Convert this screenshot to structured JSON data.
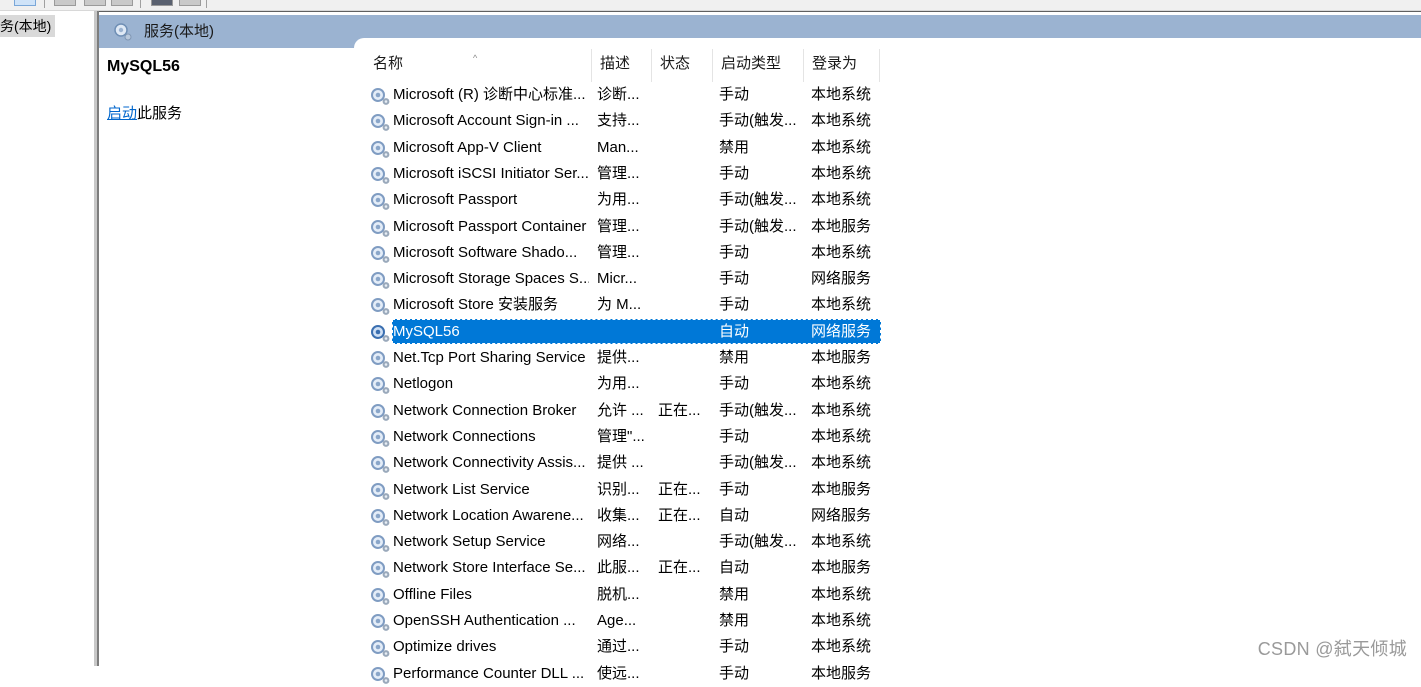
{
  "toolbar": {
    "buttons": [
      "view-extended",
      "view-standard-1",
      "view-standard-2",
      "view-standard-3",
      "properties",
      "help"
    ]
  },
  "tree": {
    "selected_item": "务(本地)"
  },
  "pane": {
    "header_title": "服务(本地)",
    "header_icon": "gear-icon"
  },
  "detail": {
    "service_name": "MySQL56",
    "action_link": "启动",
    "action_suffix": "此服务"
  },
  "table": {
    "columns": [
      "名称",
      "描述",
      "状态",
      "启动类型",
      "登录为"
    ],
    "sorted_column": "名称",
    "selected_row": "MySQL56",
    "rows": [
      {
        "name": "Microsoft (R) 诊断中心标准...",
        "desc": "诊断...",
        "status": "",
        "startup": "手动",
        "logon": "本地系统"
      },
      {
        "name": "Microsoft Account Sign-in ...",
        "desc": "支持...",
        "status": "",
        "startup": "手动(触发...",
        "logon": "本地系统"
      },
      {
        "name": "Microsoft App-V Client",
        "desc": "Man...",
        "status": "",
        "startup": "禁用",
        "logon": "本地系统"
      },
      {
        "name": "Microsoft iSCSI Initiator Ser...",
        "desc": "管理...",
        "status": "",
        "startup": "手动",
        "logon": "本地系统"
      },
      {
        "name": "Microsoft Passport",
        "desc": "为用...",
        "status": "",
        "startup": "手动(触发...",
        "logon": "本地系统"
      },
      {
        "name": "Microsoft Passport Container",
        "desc": "管理...",
        "status": "",
        "startup": "手动(触发...",
        "logon": "本地服务"
      },
      {
        "name": "Microsoft Software Shado...",
        "desc": "管理...",
        "status": "",
        "startup": "手动",
        "logon": "本地系统"
      },
      {
        "name": "Microsoft Storage Spaces S...",
        "desc": "Micr...",
        "status": "",
        "startup": "手动",
        "logon": "网络服务"
      },
      {
        "name": "Microsoft Store 安装服务",
        "desc": "为 M...",
        "status": "",
        "startup": "手动",
        "logon": "本地系统"
      },
      {
        "name": "MySQL56",
        "desc": "",
        "status": "",
        "startup": "自动",
        "logon": "网络服务"
      },
      {
        "name": "Net.Tcp Port Sharing Service",
        "desc": "提供...",
        "status": "",
        "startup": "禁用",
        "logon": "本地服务"
      },
      {
        "name": "Netlogon",
        "desc": "为用...",
        "status": "",
        "startup": "手动",
        "logon": "本地系统"
      },
      {
        "name": "Network Connection Broker",
        "desc": "允许 ...",
        "status": "正在...",
        "startup": "手动(触发...",
        "logon": "本地系统"
      },
      {
        "name": "Network Connections",
        "desc": "管理\"...",
        "status": "",
        "startup": "手动",
        "logon": "本地系统"
      },
      {
        "name": "Network Connectivity Assis...",
        "desc": "提供 ...",
        "status": "",
        "startup": "手动(触发...",
        "logon": "本地系统"
      },
      {
        "name": "Network List Service",
        "desc": "识别...",
        "status": "正在...",
        "startup": "手动",
        "logon": "本地服务"
      },
      {
        "name": "Network Location Awarene...",
        "desc": "收集...",
        "status": "正在...",
        "startup": "自动",
        "logon": "网络服务"
      },
      {
        "name": "Network Setup Service",
        "desc": "网络...",
        "status": "",
        "startup": "手动(触发...",
        "logon": "本地系统"
      },
      {
        "name": "Network Store Interface Se...",
        "desc": "此服...",
        "status": "正在...",
        "startup": "自动",
        "logon": "本地服务"
      },
      {
        "name": "Offline Files",
        "desc": "脱机...",
        "status": "",
        "startup": "禁用",
        "logon": "本地系统"
      },
      {
        "name": "OpenSSH Authentication ...",
        "desc": "Age...",
        "status": "",
        "startup": "禁用",
        "logon": "本地系统"
      },
      {
        "name": "Optimize drives",
        "desc": "通过...",
        "status": "",
        "startup": "手动",
        "logon": "本地系统"
      },
      {
        "name": "Performance Counter DLL ...",
        "desc": "使远...",
        "status": "",
        "startup": "手动",
        "logon": "本地服务"
      }
    ]
  },
  "colors": {
    "header_bg": "#9bb3d1",
    "selection": "#0078d7",
    "link": "#0066cc"
  },
  "watermark": "CSDN @弑天倾城"
}
